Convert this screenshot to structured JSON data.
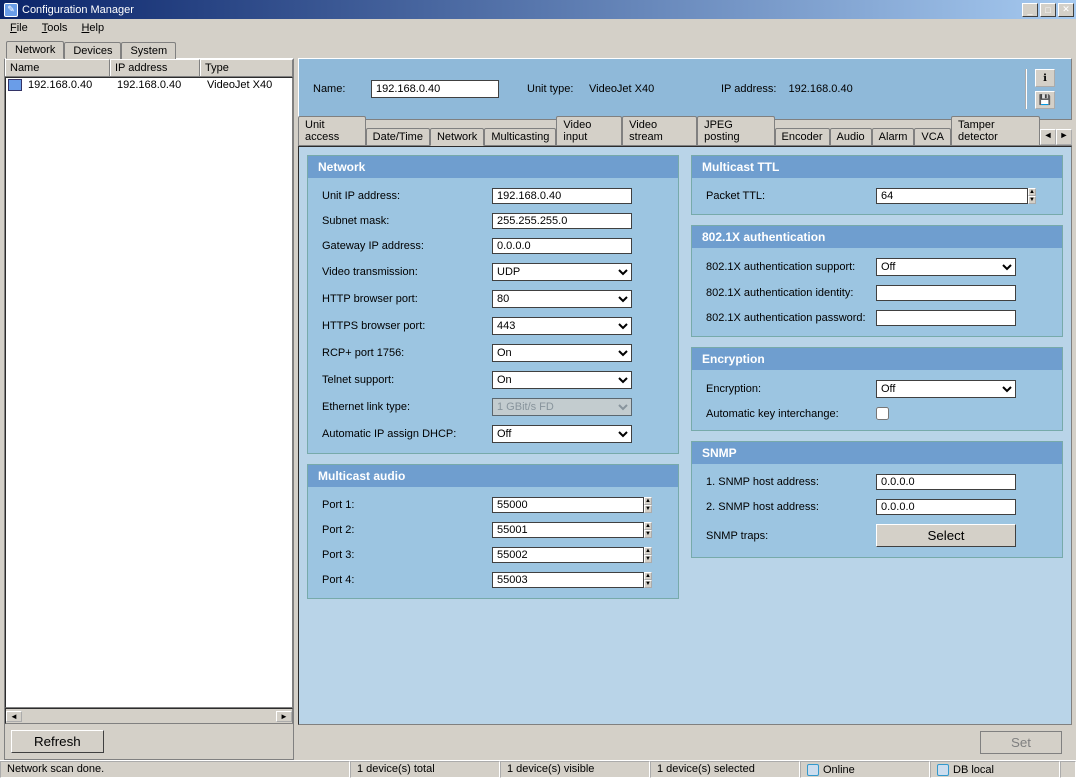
{
  "window": {
    "title": "Configuration Manager"
  },
  "menu": {
    "file": "File",
    "tools": "Tools",
    "help": "Help"
  },
  "maintabs": {
    "network": "Network",
    "devices": "Devices",
    "system": "System"
  },
  "devicetable": {
    "headers": {
      "name": "Name",
      "ip": "IP address",
      "type": "Type"
    },
    "rows": [
      {
        "name": "192.168.0.40",
        "ip": "192.168.0.40",
        "type": "VideoJet X40"
      }
    ]
  },
  "refresh_btn": "Refresh",
  "header": {
    "name_lbl": "Name:",
    "name_val": "192.168.0.40",
    "unit_lbl": "Unit type:",
    "unit_val": "VideoJet X40",
    "ip_lbl": "IP address:",
    "ip_val": "192.168.0.40"
  },
  "subtabs": [
    "Unit access",
    "Date/Time",
    "Network",
    "Multicasting",
    "Video input",
    "Video stream",
    "JPEG posting",
    "Encoder",
    "Audio",
    "Alarm",
    "VCA",
    "Tamper detector"
  ],
  "subtab_active": 2,
  "panels": {
    "network": {
      "title": "Network",
      "unit_ip_lbl": "Unit IP address:",
      "unit_ip": "192.168.0.40",
      "subnet_lbl": "Subnet mask:",
      "subnet": "255.255.255.0",
      "gateway_lbl": "Gateway IP address:",
      "gateway": "0.0.0.0",
      "vtrans_lbl": "Video transmission:",
      "vtrans": "UDP",
      "http_lbl": "HTTP browser port:",
      "http": "80",
      "https_lbl": "HTTPS browser port:",
      "https": "443",
      "rcp_lbl": "RCP+ port 1756:",
      "rcp": "On",
      "telnet_lbl": "Telnet support:",
      "telnet": "On",
      "eth_lbl": "Ethernet link type:",
      "eth": "1 GBit/s FD",
      "dhcp_lbl": "Automatic IP assign DHCP:",
      "dhcp": "Off"
    },
    "maudio": {
      "title": "Multicast audio",
      "p1_lbl": "Port 1:",
      "p1": "55000",
      "p2_lbl": "Port 2:",
      "p2": "55001",
      "p3_lbl": "Port 3:",
      "p3": "55002",
      "p4_lbl": "Port 4:",
      "p4": "55003"
    },
    "mttl": {
      "title": "Multicast TTL",
      "ttl_lbl": "Packet TTL:",
      "ttl": "64"
    },
    "auth": {
      "title": "802.1X authentication",
      "support_lbl": "802.1X authentication support:",
      "support": "Off",
      "identity_lbl": "802.1X authentication identity:",
      "identity": "",
      "password_lbl": "802.1X authentication password:",
      "password": ""
    },
    "enc": {
      "title": "Encryption",
      "enc_lbl": "Encryption:",
      "enc": "Off",
      "auto_lbl": "Automatic key interchange:"
    },
    "snmp": {
      "title": "SNMP",
      "h1_lbl": "1. SNMP host address:",
      "h1": "0.0.0.0",
      "h2_lbl": "2. SNMP host address:",
      "h2": "0.0.0.0",
      "traps_lbl": "SNMP traps:",
      "select_btn": "Select"
    }
  },
  "set_btn": "Set",
  "status": {
    "scan": "Network scan done.",
    "total": "1 device(s) total",
    "visible": "1 device(s) visible",
    "selected": "1 device(s) selected",
    "online": "Online",
    "db": "DB local"
  }
}
